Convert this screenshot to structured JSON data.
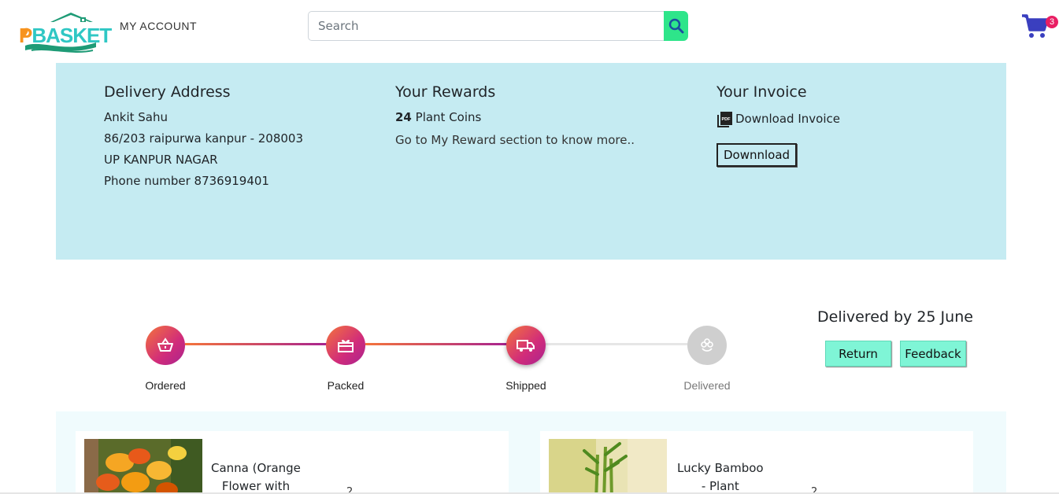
{
  "header": {
    "logo_text": "PBASKET",
    "my_account": "MY ACCOUNT",
    "search_placeholder": "Search",
    "cart_count": "3"
  },
  "address": {
    "title": "Delivery Address",
    "name": "Ankit Sahu",
    "line1": "86/203 raipurwa kanpur - 208003",
    "line2": "UP KANPUR NAGAR",
    "phone": "Phone number 8736919401"
  },
  "rewards": {
    "title": "Your Rewards",
    "coins": "24",
    "coins_label": " Plant Coins",
    "note": "Go to My Reward section to know more.."
  },
  "invoice": {
    "title": "Your Invoice",
    "link": "Download Invoice",
    "button": "Downnload"
  },
  "tracker": {
    "steps": [
      {
        "label": "Ordered",
        "icon": "basket-icon",
        "done": true
      },
      {
        "label": "Packed",
        "icon": "gift-box-icon",
        "done": true
      },
      {
        "label": "Shipped",
        "icon": "truck-icon",
        "done": true
      },
      {
        "label": "Delivered",
        "icon": "flower-icon",
        "done": false
      }
    ],
    "delivered_by": "Delivered by 25 June",
    "return_button": "Return",
    "feedback_button": "Feedback"
  },
  "products": [
    {
      "name_line1": "Canna (Orange",
      "name_line2": "Flower with",
      "qty": "2"
    },
    {
      "name_line1": "Lucky Bamboo",
      "name_line2": "- Plant",
      "qty": "2"
    }
  ],
  "colors": {
    "panel_bg": "#c5ebf2",
    "accent_green": "#2ee58a",
    "action_button": "#7ff5d6",
    "progress_gradient_start": "#f4743b",
    "progress_gradient_end": "#a8238f",
    "cart_icon": "#3a3fbf",
    "badge": "#e91e63"
  }
}
